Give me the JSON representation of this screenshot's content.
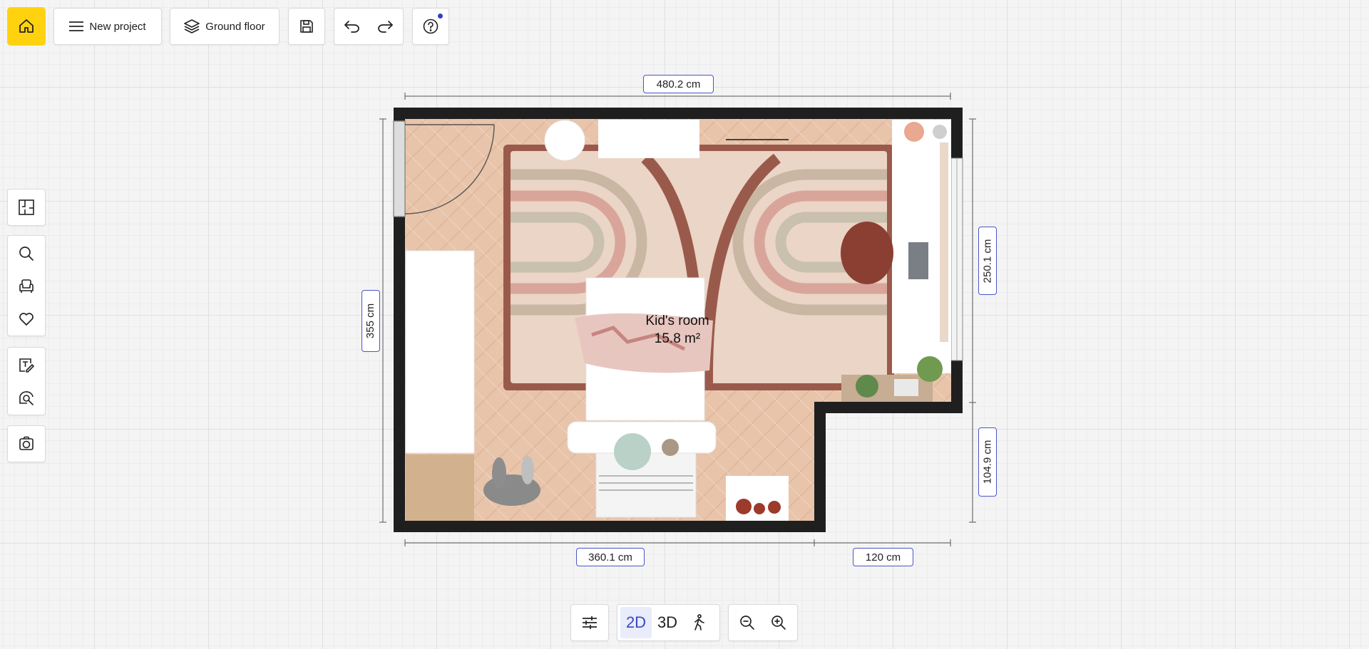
{
  "toolbar": {
    "project_label": "New project",
    "floor_label": "Ground floor"
  },
  "room": {
    "name": "Kid's room",
    "area": "15.8 m²"
  },
  "dimensions": {
    "top": "480.2 cm",
    "left": "355 cm",
    "right_upper": "250.1 cm",
    "right_lower": "104.9 cm",
    "bottom_left": "360.1 cm",
    "bottom_right": "120 cm"
  },
  "view_modes": {
    "mode_2d": "2D",
    "mode_3d": "3D",
    "active": "2D"
  },
  "icons": {
    "home": "home-icon",
    "menu": "menu-icon",
    "layers": "layers-icon",
    "save": "save-icon",
    "undo": "undo-icon",
    "redo": "redo-icon",
    "help": "help-icon",
    "floorplan": "floorplan-icon",
    "search": "search-icon",
    "furniture": "armchair-icon",
    "favorites": "heart-icon",
    "annotate": "text-edit-icon",
    "measure": "measure-icon",
    "camera": "camera-icon",
    "settings": "sliders-icon",
    "walk": "walk-icon",
    "zoom_out": "zoom-out-icon",
    "zoom_in": "zoom-in-icon"
  },
  "colors": {
    "accent": "#ffd20f",
    "selection": "#3b47c4",
    "wall": "#1f1f1f",
    "floor": "#e7c3aa"
  }
}
